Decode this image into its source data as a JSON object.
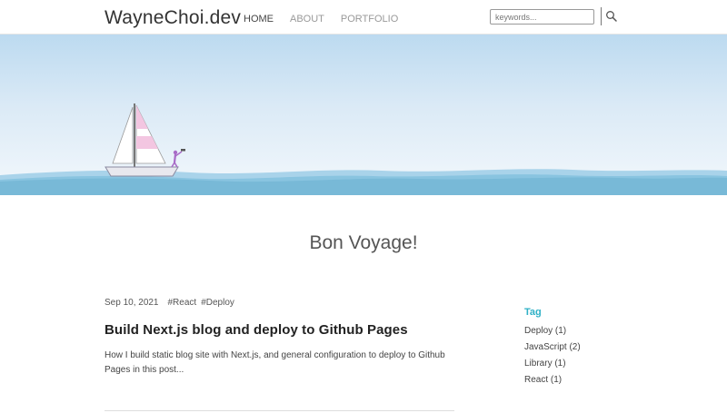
{
  "header": {
    "logo": "WayneChoi.dev",
    "nav": [
      {
        "label": "HOME",
        "active": true
      },
      {
        "label": "ABOUT",
        "active": false
      },
      {
        "label": "PORTFOLIO",
        "active": false
      }
    ],
    "search": {
      "placeholder": "keywords..."
    },
    "search_icon": "search-icon"
  },
  "hero": {
    "sky_color": "#cfe4f3",
    "water_color": "#7fbcd9",
    "sail_color": "#f3c6e1",
    "person_color": "#a86bc7"
  },
  "main": {
    "title": "Bon Voyage!",
    "post": {
      "date": "Sep 10, 2021",
      "tags": [
        "#React",
        "#Deploy"
      ],
      "title": "Build Next.js blog and deploy to Github Pages",
      "description": "How I build static blog site with Next.js, and general configuration to deploy to Github Pages in this post..."
    }
  },
  "sidebar": {
    "heading": "Tag",
    "accent": "#2fb1c6",
    "tags": [
      {
        "label": "Deploy (1)"
      },
      {
        "label": "JavaScript (2)"
      },
      {
        "label": "Library (1)"
      },
      {
        "label": "React (1)"
      }
    ]
  }
}
